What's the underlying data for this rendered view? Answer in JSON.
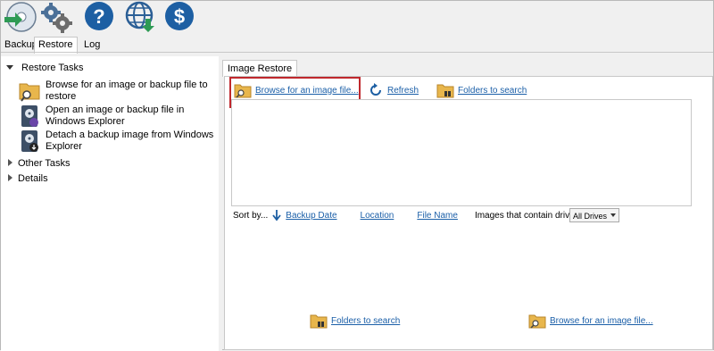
{
  "toolbar": {
    "icons": [
      {
        "name": "disk-restore-icon"
      },
      {
        "name": "settings-gears-icon"
      },
      {
        "name": "help-icon"
      },
      {
        "name": "web-download-icon"
      },
      {
        "name": "dollar-icon"
      }
    ]
  },
  "tabs": [
    {
      "label": "Backup"
    },
    {
      "label": "Restore"
    },
    {
      "label": "Log"
    }
  ],
  "left_panel": {
    "restore_tasks_title": "Restore Tasks",
    "tasks": [
      {
        "label": "Browse for an image or backup file to restore"
      },
      {
        "label": "Open an image or backup file in Windows Explorer"
      },
      {
        "label": "Detach a backup image from Windows Explorer"
      }
    ],
    "other_tasks": "Other Tasks",
    "details": "Details"
  },
  "main": {
    "tab_label": "Image Restore",
    "browse_link": "Browse for an image file...",
    "refresh_link": "Refresh",
    "folders_link": "Folders to search",
    "sort_by_label": "Sort by...",
    "sort_backup_date": "Backup Date",
    "sort_location": "Location",
    "sort_file_name": "File Name",
    "images_drive_label": "Images that contain drive:",
    "drive_select_value": "All Drives",
    "bottom_folders_link": "Folders to search",
    "bottom_browse_link": "Browse for an image file..."
  }
}
